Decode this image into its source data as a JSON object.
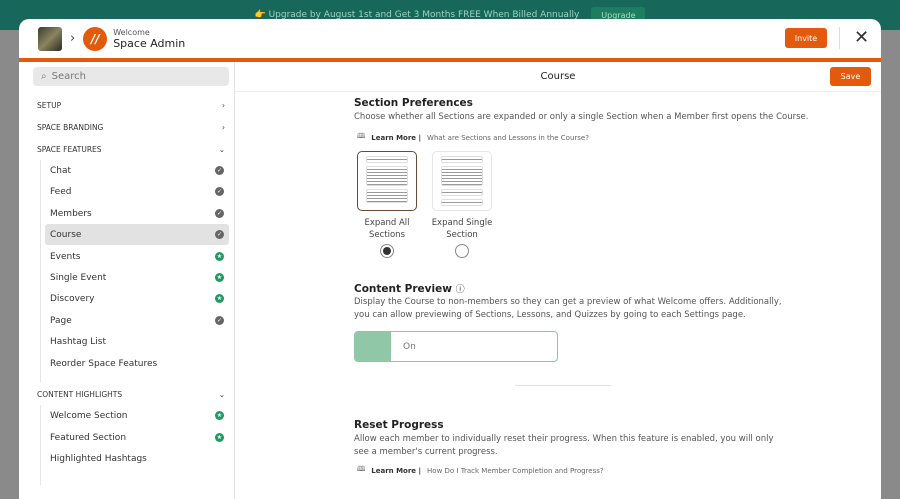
{
  "banner": {
    "text": "👉 Upgrade by August 1st and Get 3 Months FREE When Billed Annually",
    "button": "Upgrade"
  },
  "header": {
    "subtitle": "Welcome",
    "title": "Space Admin",
    "invite": "Invite",
    "close": "✕"
  },
  "sidebar": {
    "search_placeholder": "Search",
    "sections": [
      {
        "label": "SETUP"
      },
      {
        "label": "SPACE BRANDING"
      },
      {
        "label": "SPACE FEATURES"
      },
      {
        "label": "CONTENT HIGHLIGHTS"
      }
    ],
    "features": [
      {
        "label": "Chat",
        "status": "check"
      },
      {
        "label": "Feed",
        "status": "check"
      },
      {
        "label": "Members",
        "status": "check"
      },
      {
        "label": "Course",
        "status": "check"
      },
      {
        "label": "Events",
        "status": "star"
      },
      {
        "label": "Single Event",
        "status": "star"
      },
      {
        "label": "Discovery",
        "status": "star"
      },
      {
        "label": "Page",
        "status": "check"
      },
      {
        "label": "Hashtag List"
      },
      {
        "label": "Reorder Space Features"
      }
    ],
    "highlights": [
      {
        "label": "Welcome Section",
        "status": "star"
      },
      {
        "label": "Featured Section",
        "status": "star"
      },
      {
        "label": "Highlighted Hashtags"
      }
    ]
  },
  "main": {
    "title": "Course",
    "save": "Save",
    "section_prefs": {
      "heading": "Section Preferences",
      "desc": "Choose whether all Sections are expanded or only a single Section when a Member first opens the Course.",
      "learn_more": "Learn More |",
      "link": "What are Sections and Lessons in the Course?",
      "options": [
        {
          "label": "Expand All Sections",
          "selected": true
        },
        {
          "label": "Expand Single Section",
          "selected": false
        }
      ]
    },
    "content_preview": {
      "heading": "Content Preview",
      "desc": "Display the Course to non-members so they can get a preview of what Welcome offers. Additionally, you can allow previewing of Sections, Lessons, and Quizzes by going to each Settings page.",
      "toggle": "On"
    },
    "reset_progress": {
      "heading": "Reset Progress",
      "desc": "Allow each member to individually reset their progress. When this feature is enabled, you will only see a member's current progress.",
      "learn_more": "Learn More |",
      "link": "How Do I Track Member Completion and Progress?"
    }
  }
}
